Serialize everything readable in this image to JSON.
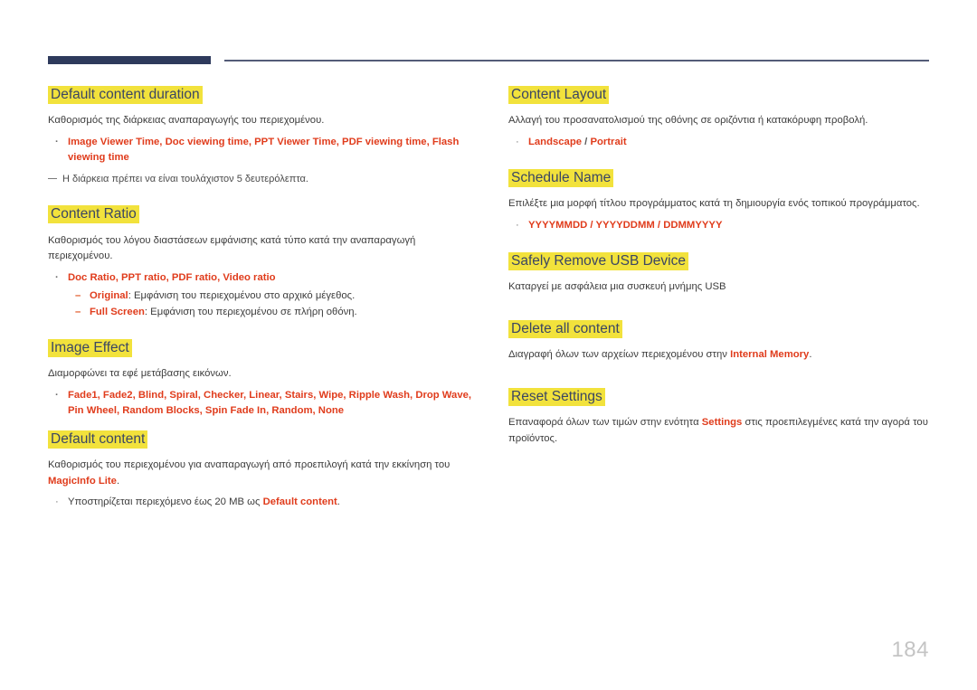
{
  "page": {
    "number": "184"
  },
  "left_column": [
    {
      "id": "default-content-duration",
      "heading": "Default content duration",
      "paragraph": "Καθορισμός της διάρκειας αναπαραγωγής του περιεχομένου.",
      "bullet_options": "Image Viewer Time, Doc viewing time, PPT Viewer Time, PDF viewing time, Flash viewing time",
      "note": "Η διάρκεια πρέπει να είναι τουλάχιστον 5 δευτερόλεπτα."
    },
    {
      "id": "content-ratio",
      "heading": "Content Ratio",
      "paragraph": "Καθορισμός του λόγου διαστάσεων εμφάνισης κατά τύπο κατά την αναπαραγωγή περιεχομένου.",
      "bullet_options": "Doc Ratio, PPT ratio, PDF ratio, Video ratio",
      "sub_bullets": [
        {
          "term": "Original",
          "rest": ": Εμφάνιση του περιεχομένου στο αρχικό μέγεθος."
        },
        {
          "term": "Full Screen",
          "rest": ": Εμφάνιση του περιεχομένου σε πλήρη οθόνη."
        }
      ]
    },
    {
      "id": "image-effect",
      "heading": "Image Effect",
      "paragraph": "Διαμορφώνει τα εφέ μετάβασης εικόνων.",
      "bullet_options": "Fade1, Fade2, Blind, Spiral, Checker, Linear, Stairs, Wipe, Ripple Wash, Drop Wave, Pin Wheel, Random Blocks, Spin Fade In, Random, None"
    },
    {
      "id": "default-content",
      "heading": "Default content",
      "paragraph_pre": "Καθορισμός του περιεχομένου για αναπαραγωγή από προεπιλογή κατά την εκκίνηση του ",
      "paragraph_term": "MagicInfo Lite",
      "paragraph_post": ".",
      "bullet_pre": "Υποστηρίζεται περιεχόμενο έως 20 MB ως ",
      "bullet_term": "Default content",
      "bullet_post": "."
    }
  ],
  "right_column": [
    {
      "id": "content-layout",
      "heading": "Content Layout",
      "paragraph": "Αλλαγή του προσανατολισμού της οθόνης σε οριζόντια ή κατακόρυφη προβολή.",
      "options": [
        "Landscape",
        "Portrait"
      ],
      "separator": "/"
    },
    {
      "id": "schedule-name",
      "heading": "Schedule Name",
      "paragraph": "Επιλέξτε μια μορφή τίτλου προγράμματος κατά τη δημιουργία ενός τοπικού προγράμματος.",
      "options": [
        "YYYYMMDD",
        "YYYYDDMM",
        "DDMMYYYY"
      ],
      "separator": "/"
    },
    {
      "id": "safely-remove-usb-device",
      "heading": "Safely Remove USB Device",
      "paragraph": "Καταργεί με ασφάλεια μια συσκευή μνήμης USB"
    },
    {
      "id": "delete-all-content",
      "heading": "Delete all content",
      "paragraph_pre": "Διαγραφή όλων των αρχείων περιεχομένου στην ",
      "paragraph_term": "Internal Memory",
      "paragraph_post": "."
    },
    {
      "id": "reset-settings",
      "heading": "Reset Settings",
      "paragraph_pre": "Επαναφορά όλων των τιμών στην ενότητα ",
      "paragraph_term": "Settings",
      "paragraph_post": " στις προεπιλεγμένες κατά την αγορά του προϊόντος."
    }
  ],
  "colors": {
    "header_bar": "#2e3a5c",
    "header_line": "#545c78",
    "highlight": "#f2e23c",
    "heading_text": "#3b4663",
    "term_red": "#e03c1c",
    "body_text": "#3c3c3c",
    "page_number": "#c4c4c4"
  }
}
